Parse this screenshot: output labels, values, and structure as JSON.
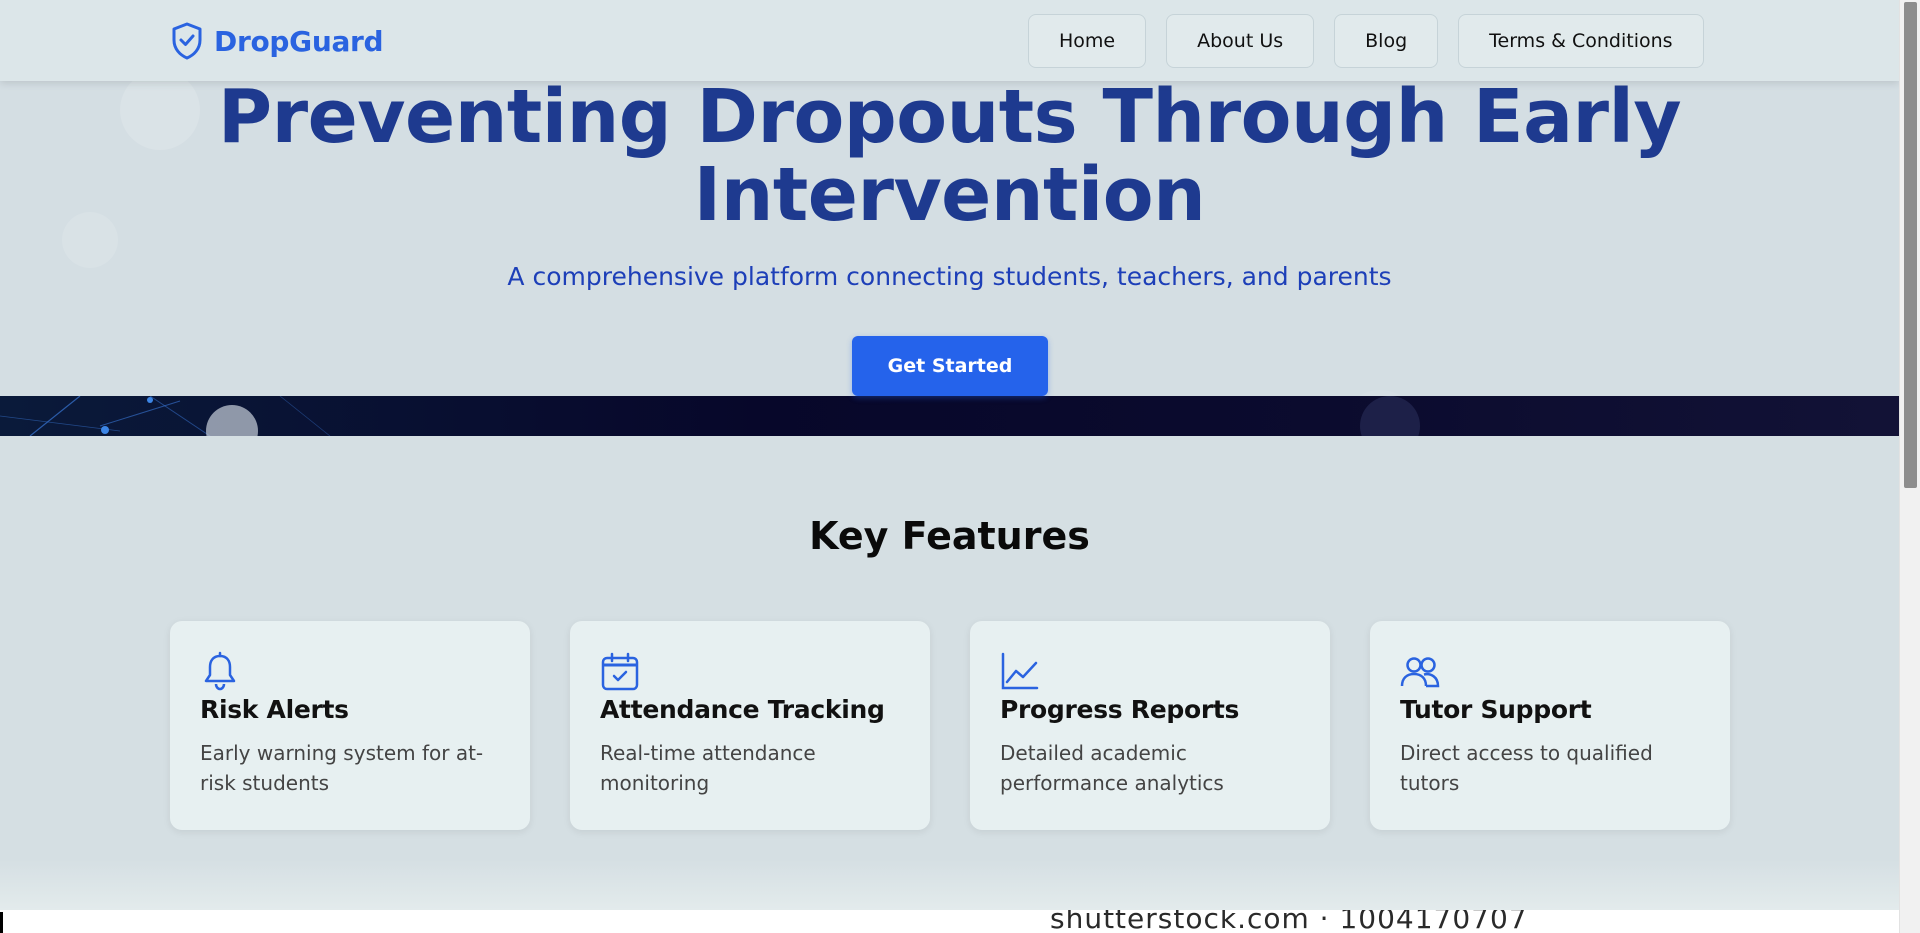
{
  "brand": {
    "name": "DropGuard",
    "icon": "shield-check-icon",
    "color": "#2a63e0"
  },
  "nav": {
    "items": [
      {
        "label": "Home"
      },
      {
        "label": "About Us"
      },
      {
        "label": "Blog"
      },
      {
        "label": "Terms & Conditions"
      }
    ]
  },
  "hero": {
    "title_line1": "Preventing Dropouts Through Early",
    "title_line2": "Intervention",
    "subtitle": "A comprehensive platform connecting students, teachers, and parents",
    "cta_label": "Get Started"
  },
  "features": {
    "title": "Key Features",
    "items": [
      {
        "icon": "bell-icon",
        "title": "Risk Alerts",
        "desc": "Early warning system for at-risk students"
      },
      {
        "icon": "calendar-check-icon",
        "title": "Attendance Tracking",
        "desc": "Real-time attendance monitoring"
      },
      {
        "icon": "chart-line-icon",
        "title": "Progress Reports",
        "desc": "Detailed academic performance analytics"
      },
      {
        "icon": "users-icon",
        "title": "Tutor Support",
        "desc": "Direct access to qualified tutors"
      }
    ]
  },
  "watermark": {
    "text": "shutterstock.com · 1004170707"
  },
  "colors": {
    "accent": "#2563eb",
    "heading": "#1e3a8f",
    "background": "#d4dee3"
  }
}
